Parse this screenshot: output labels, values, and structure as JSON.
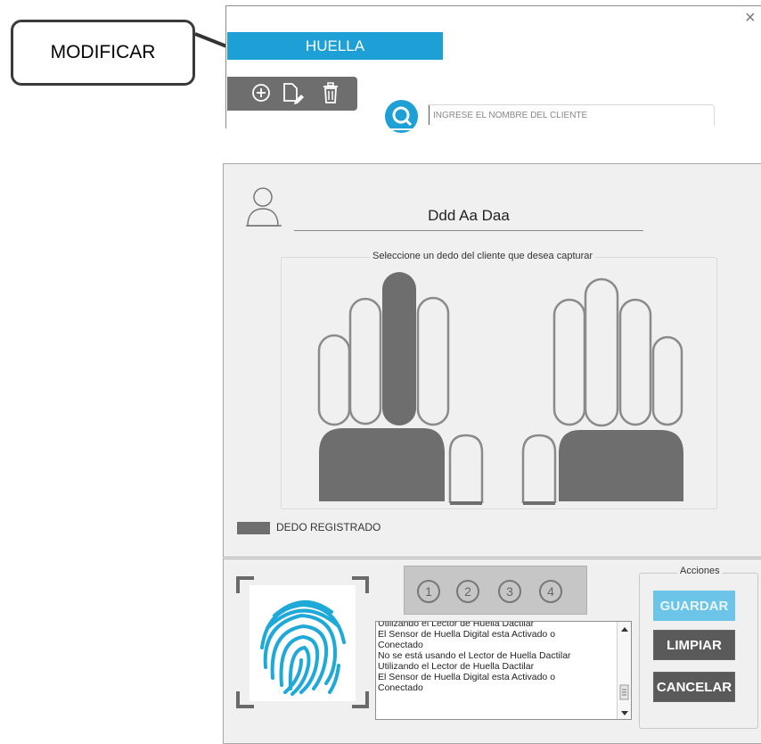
{
  "callout": {
    "label": "MODIFICAR"
  },
  "header": {
    "tab_label": "HUELLA",
    "close_symbol": "×",
    "toolbar": {
      "add_icon": "plus-circle-icon",
      "edit_icon": "edit-document-icon",
      "delete_icon": "trash-icon"
    },
    "search": {
      "placeholder": "INGRESE EL NOMBRE DEL CLIENTE",
      "value": ""
    }
  },
  "client": {
    "name": "Ddd Aa Daa",
    "icon": "user-icon"
  },
  "fingers": {
    "group_title": "Seleccione un  dedo del cliente que desea capturar",
    "registered": [
      "left-middle",
      "left-thumb",
      "right-thumb"
    ],
    "legend_label": "DEDO REGISTRADO",
    "colors": {
      "registered": "#6e6e6e",
      "outline": "#8a8a8a"
    }
  },
  "capture": {
    "steps": [
      "1",
      "2",
      "3",
      "4"
    ],
    "log_lines": [
      "Utilizando el Lector de Huella Dactilar",
      "El Sensor de Huella Digital esta Activado o",
      "Conectado",
      "No se está usando el Lector de Huella Dactilar",
      "Utilizando el Lector de Huella Dactilar",
      "El Sensor de Huella Digital esta Activado o",
      "Conectado"
    ],
    "fingerprint_icon": "fingerprint-icon"
  },
  "actions": {
    "title": "Acciones",
    "save_label": "GUARDAR",
    "clear_label": "LIMPIAR",
    "cancel_label": "CANCELAR",
    "colors": {
      "save": "#6cc4e8",
      "default": "#5a5a5a"
    }
  }
}
